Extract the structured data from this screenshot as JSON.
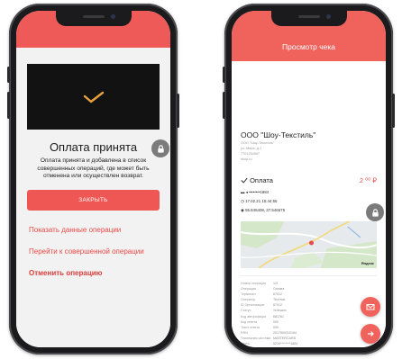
{
  "left_phone": {
    "title": "Оплата принята",
    "description": "Оплата принята и добавлена в список совершенных операций, где может быть отменена или осуществлен возврат.",
    "close_label": "ЗАКРЫТЬ",
    "links": [
      "Показать данные операции",
      "Перейти к совершенной операции",
      "Отменить операцию"
    ]
  },
  "right_phone": {
    "title": "Просмотр чека",
    "company": "ООО \"Шоу-Текстиль\"",
    "company_details": [
      "ООО \"Шоу-Текстиль\"",
      "ул. Мира, д.1",
      "7701234567",
      "shop.ru"
    ],
    "payment_label": "Оплата",
    "amount": "2 ⁰⁰ ₽",
    "card": "••••••••1884",
    "datetime": "17.02.21 15:44:55",
    "location": "55.845408, 37.546675",
    "map_brand": "Яндекс",
    "receipt_rows": [
      {
        "k": "Номер операции",
        "v": "1/3"
      },
      {
        "k": "Операция",
        "v": "Оплата"
      },
      {
        "k": "Терминал",
        "v": "67012"
      },
      {
        "k": "Оператор",
        "v": "Тесттов"
      },
      {
        "k": "ID Организации",
        "v": "67012"
      },
      {
        "k": "Статус",
        "v": "Успешно"
      },
      {
        "k": "Код авторизации",
        "v": "681761"
      },
      {
        "k": "Код ответа",
        "v": "000"
      },
      {
        "k": "Текст ответа",
        "v": "000"
      },
      {
        "k": "RRN",
        "v": "2017500310184"
      },
      {
        "k": "Платежная система",
        "v": "MASTERCARD"
      },
      {
        "k": "Карта",
        "v": "5224********1884"
      }
    ]
  },
  "colors": {
    "accent": "#ee5a57",
    "link": "#e84b48",
    "lock_badge": "#7b7b7b"
  },
  "icons": [
    "checkmark-icon",
    "lock-icon",
    "mail-icon",
    "arrow-right-icon",
    "check-icon",
    "card-icon",
    "clock-icon",
    "location-icon"
  ]
}
